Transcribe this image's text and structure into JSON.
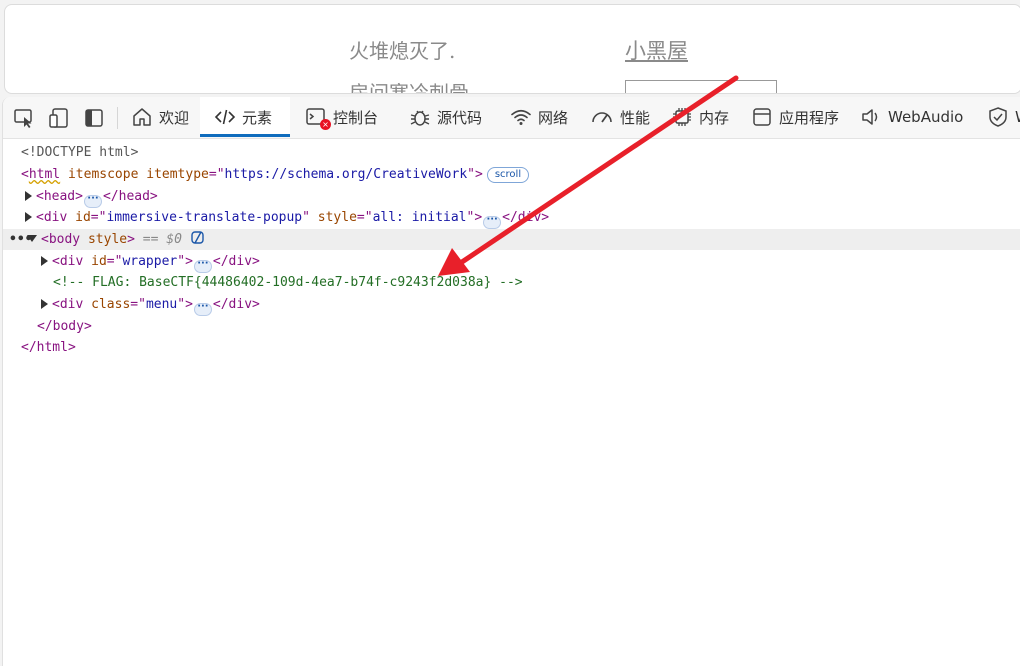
{
  "page": {
    "line1": "火堆熄灭了.",
    "line2": "房间寒冷刺骨",
    "link": "小黑屋"
  },
  "toolbar": {
    "tabs": [
      {
        "label": "欢迎",
        "icon": "home-icon"
      },
      {
        "label": "元素",
        "icon": "code-icon"
      },
      {
        "label": "控制台",
        "icon": "console-icon"
      },
      {
        "label": "源代码",
        "icon": "bug-icon"
      },
      {
        "label": "网络",
        "icon": "wifi-icon"
      },
      {
        "label": "性能",
        "icon": "gauge-icon"
      },
      {
        "label": "内存",
        "icon": "chip-icon"
      },
      {
        "label": "应用程序",
        "icon": "app-icon"
      },
      {
        "label": "WebAudio",
        "icon": "speaker-icon"
      },
      {
        "label": "W",
        "icon": "shield-icon"
      }
    ],
    "active_tab": "元素",
    "accent": "#0f6cbd",
    "error_color": "#e81123"
  },
  "dom": {
    "doctype": "<!DOCTYPE html>",
    "html_open": {
      "tag": "html",
      "attr1": "itemscope",
      "attr2": "itemtype",
      "attr2_value": "https://schema.org/CreativeWork",
      "badge": "scroll"
    },
    "head": {
      "open": "<head>",
      "close": "</head>"
    },
    "div_popup": {
      "attr": "id",
      "value": "immersive-translate-popup",
      "attr2": "style",
      "value2": "all: initial"
    },
    "body": {
      "tag": "body",
      "attr": "style",
      "selected_marker": "== $0"
    },
    "div_wrapper": {
      "attr": "id",
      "value": "wrapper"
    },
    "comment": "<!-- FLAG: BaseCTF{44486402-109d-4ea7-b74f-c9243f2d038a} -->",
    "div_menu": {
      "attr": "class",
      "value": "menu"
    },
    "body_close": "</body>",
    "html_close": "</html>"
  },
  "annotation": {
    "arrow_color": "#e8202a"
  }
}
